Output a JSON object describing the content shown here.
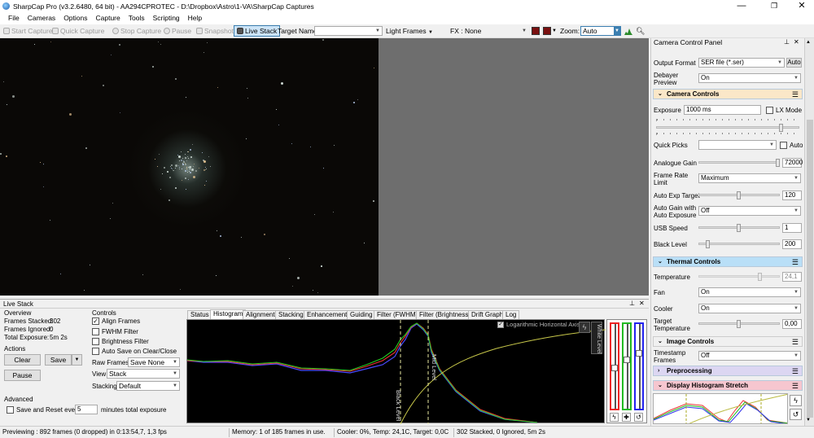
{
  "window": {
    "title": "SharpCap Pro (v3.2.6480, 64 bit) - AA294CPROTEC - D:\\Dropbox\\Astro\\1-VA\\SharpCap Captures",
    "minimize": "—",
    "maximize": "❐",
    "close": "✕"
  },
  "menu": [
    "File",
    "Cameras",
    "Options",
    "Capture",
    "Tools",
    "Scripting",
    "Help"
  ],
  "toolbar": {
    "start_capture": "Start Capture",
    "quick_capture": "Quick Capture",
    "stop_capture": "Stop Capture",
    "pause": "Pause",
    "snapshot": "Snapshot",
    "live_stack": "Live Stack",
    "target_name_label": "Target Name :",
    "target_name_value": "",
    "frame_type": "Light Frames",
    "fx_label": "FX :",
    "fx_value": "None",
    "zoom_label": "Zoom:",
    "zoom_value": "Auto"
  },
  "live_stack": {
    "panel_title": "Live Stack",
    "overview_header": "Overview",
    "frames_stacked_label": "Frames Stacked:",
    "frames_stacked_value": "302",
    "frames_ignored_label": "Frames Ignored:",
    "frames_ignored_value": "0",
    "total_exposure_label": "Total Exposure:",
    "total_exposure_value": "5m 2s",
    "actions_header": "Actions",
    "clear": "Clear",
    "save": "Save",
    "pause": "Pause",
    "advanced_header": "Advanced",
    "save_reset_label": "Save and Reset every",
    "save_reset_value": "5",
    "save_reset_suffix": "minutes total exposure",
    "controls_header": "Controls",
    "align_frames": "Align Frames",
    "fwhm_filter": "FWHM Filter",
    "brightness_filter": "Brightness Filter",
    "auto_save": "Auto Save on Clear/Close",
    "raw_frames_label": "Raw Frames",
    "raw_frames_value": "Save None",
    "view_label": "View",
    "view_value": "Stack",
    "stacking_label": "Stacking",
    "stacking_value": "Default",
    "tabs": [
      "Status",
      "Histogram",
      "Alignment",
      "Stacking",
      "Enhancement",
      "Guiding",
      "Filter (FWHM)",
      "Filter (Brightness)",
      "Drift Graph",
      "Log"
    ],
    "active_tab": "Histogram",
    "histogram": {
      "log_axis_label": "Logarithmic Horizontal Axis",
      "black_level_label": "Black Level",
      "mid_level_label": "Mid Level",
      "white_level_label": "White Level"
    }
  },
  "camera_panel": {
    "title": "Camera Control Panel",
    "output_format_label": "Output Format",
    "output_format_value": "SER file (*.ser)",
    "auto_label": "Auto",
    "debayer_label": "Debayer Preview",
    "debayer_value": "On",
    "sections": {
      "camera_controls": "Camera Controls",
      "thermal_controls": "Thermal Controls",
      "image_controls": "Image Controls",
      "preprocessing": "Preprocessing",
      "display_histogram": "Display Histogram Stretch"
    },
    "exposure_label": "Exposure",
    "exposure_value": "1000 ms",
    "lx_mode": "LX Mode",
    "quick_picks_label": "Quick Picks",
    "quick_picks_auto": "Auto",
    "analogue_gain_label": "Analogue Gain",
    "analogue_gain_value": "72000",
    "frame_rate_label": "Frame Rate Limit",
    "frame_rate_value": "Maximum",
    "auto_exp_target_label": "Auto Exp Target",
    "auto_exp_target_value": "120",
    "auto_gain_label": "Auto Gain with Auto Exposure",
    "auto_gain_value": "Off",
    "usb_speed_label": "USB Speed",
    "usb_speed_value": "1",
    "black_level_label": "Black Level",
    "black_level_value": "200",
    "temperature_label": "Temperature",
    "temperature_value": "24,1",
    "fan_label": "Fan",
    "fan_value": "On",
    "cooler_label": "Cooler",
    "cooler_value": "On",
    "target_temp_label": "Target Temperature",
    "target_temp_value": "0,00",
    "timestamp_label": "Timestamp Frames",
    "timestamp_value": "Off"
  },
  "statusbar": {
    "previewing": "Previewing : 892 frames (0 dropped) in 0:13:54,7, 1,3 fps",
    "memory": "Memory: 1 of 185 frames in use.",
    "cooler": "Cooler: 0%, Temp: 24,1C, Target: 0,0C",
    "stacked": "302 Stacked, 0 Ignored, 5m 2s"
  },
  "colors": {
    "camera_controls_header": "#fbe7c8",
    "thermal_controls_header": "#b9dff7",
    "preprocessing_header": "#dcd6f2",
    "display_histogram_header": "#f6c6cf",
    "live_stack_button_bg": "#cce4f7"
  },
  "icons": {
    "app": "sharpcap-logo-icon",
    "dropdown": "chevron-down-icon",
    "menu": "hamburger-icon",
    "pin": "pin-icon"
  }
}
